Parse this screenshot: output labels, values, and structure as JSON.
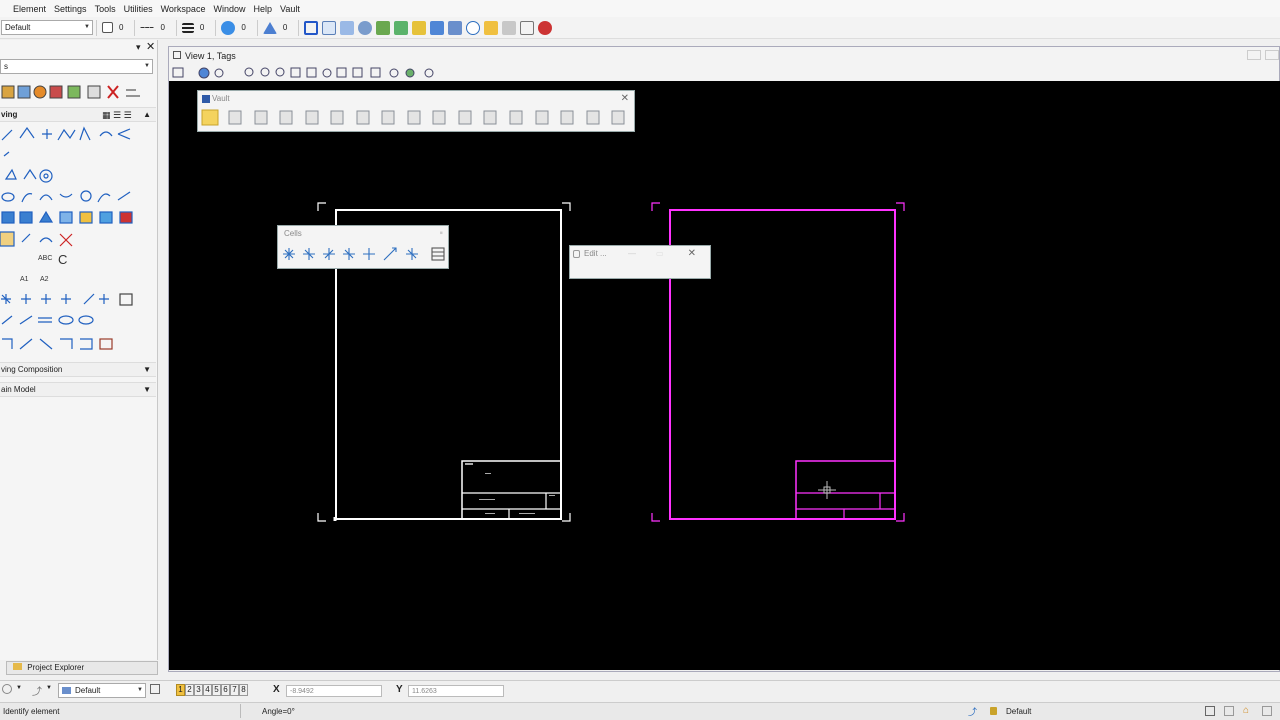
{
  "menu": [
    "Element",
    "Settings",
    "Tools",
    "Utilities",
    "Workspace",
    "Window",
    "Help",
    "Vault"
  ],
  "attributes": {
    "level": "Default",
    "color_value": "0",
    "style_value": "0",
    "weight_value": "0",
    "transparency_value": "0",
    "priority_value": "0"
  },
  "left_panel": {
    "search_value": "s",
    "drawing_section": "ving",
    "drawing_composition": "ving Composition",
    "main_model": "ain Model",
    "text_abc": "ABC",
    "text_a1": "A1",
    "text_a2": "A2",
    "text_c": "C"
  },
  "project_explorer_tab": "Project Explorer",
  "view": {
    "title": "View 1, Tags"
  },
  "vault_toolbox": {
    "title": "Vault"
  },
  "cells_toolbox": {
    "title": "Cells"
  },
  "edit_toolbox": {
    "title": "Edit ..."
  },
  "coords": {
    "view_numbers": [
      "1",
      "2",
      "3",
      "4",
      "5",
      "6",
      "7",
      "8"
    ],
    "model": "Default",
    "x_label": "X",
    "x_value": "-8.9492",
    "y_label": "Y",
    "y_value": "11.6263"
  },
  "status": {
    "prompt": "Identify element",
    "angle": "Angle=0°",
    "level": "Default"
  },
  "colors": {
    "magenta": "#ff33ff",
    "white": "#ffffff",
    "canvas": "#000000"
  }
}
